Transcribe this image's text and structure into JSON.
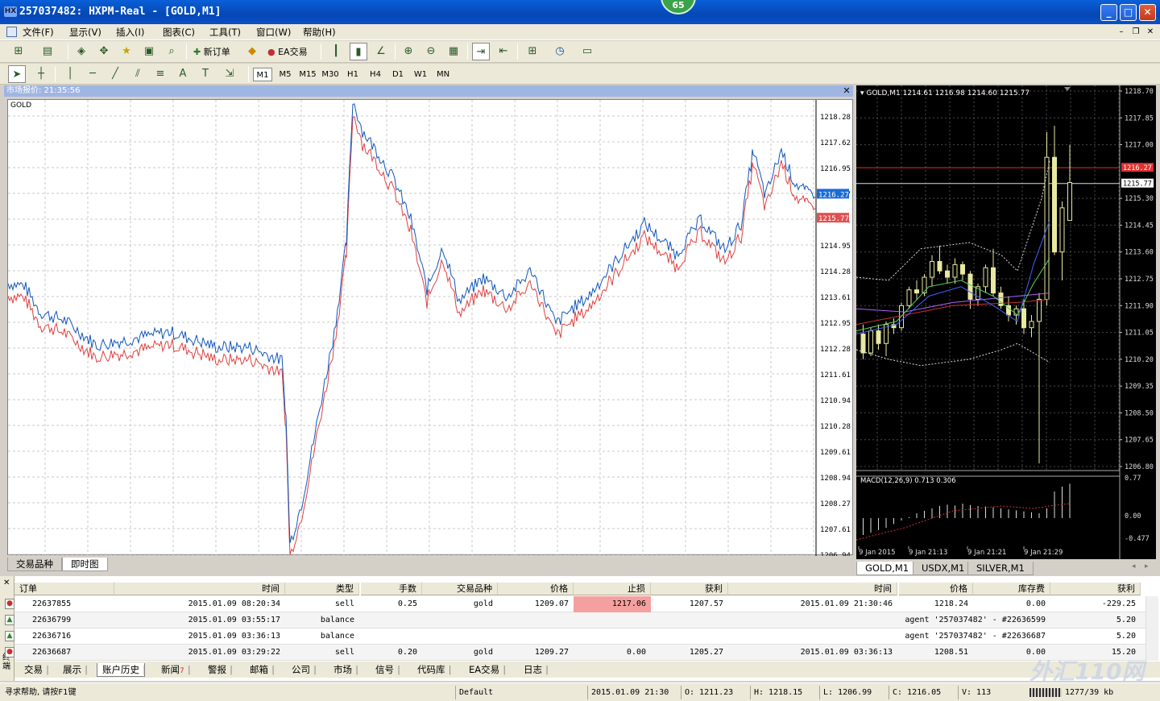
{
  "window": {
    "title": "257037482: HXPM-Real - [GOLD,M1]",
    "logo": "HX",
    "badge": "65"
  },
  "menu": [
    "文件(F)",
    "显示(V)",
    "插入(I)",
    "图表(C)",
    "工具(T)",
    "窗口(W)",
    "帮助(H)"
  ],
  "toolbar": {
    "new_order": "新订单",
    "ea_trade": "EA交易"
  },
  "timeframes": [
    "M1",
    "M5",
    "M15",
    "M30",
    "H1",
    "H4",
    "D1",
    "W1",
    "MN"
  ],
  "active_timeframe": "M1",
  "market_watch": {
    "header": "市场报价: 21:35:56",
    "tabs": [
      "交易品种",
      "即时图"
    ],
    "active_tab": "即时图"
  },
  "tick_chart": {
    "symbol": "GOLD",
    "bid_label": "1216.27",
    "ask_label": "1215.77",
    "colors": {
      "bid": "#1155bb",
      "ask": "#e04040",
      "bid_tag": "#1a6bd6",
      "ask_tag": "#e05050"
    },
    "y_ticks": [
      "1218.28",
      "1217.62",
      "1216.95",
      "1216.27",
      "1215.61",
      "1214.95",
      "1214.28",
      "1213.61",
      "1212.95",
      "1212.28",
      "1211.61",
      "1210.94",
      "1210.28",
      "1209.61",
      "1208.94",
      "1208.27",
      "1207.61",
      "1206.94"
    ]
  },
  "candle_chart": {
    "header": "GOLD,M1  1214.61 1216.98 1214.60 1215.77",
    "y_ticks": [
      "1218.70",
      "1217.85",
      "1217.00",
      "1216.27",
      "1215.77",
      "1215.30",
      "1214.45",
      "1213.60",
      "1212.75",
      "1211.90",
      "1211.05",
      "1210.20",
      "1209.35",
      "1208.50",
      "1207.65",
      "1206.80"
    ],
    "red_tag": "1216.27",
    "white_tag": "1215.77",
    "macd_label": "MACD(12,26,9) 0.713 0.306",
    "macd_ticks": [
      "0.77",
      "0.00",
      "-0.477"
    ],
    "x_labels": [
      "9 Jan 2015",
      "9 Jan 21:13",
      "9 Jan 21:21",
      "9 Jan 21:29"
    ],
    "tabs": [
      "GOLD,M1",
      "USDX,M1",
      "SILVER,M1"
    ],
    "active_tab": "GOLD,M1"
  },
  "terminal": {
    "columns": [
      "订单",
      "时间",
      "类型",
      "手数",
      "交易品种",
      "价格",
      "止损",
      "获利",
      "时间",
      "价格",
      "库存费",
      "获利"
    ],
    "rows": [
      {
        "order": "22637855",
        "time": "2015.01.09 08:20:34",
        "type": "sell",
        "lots": "0.25",
        "symbol": "gold",
        "price": "1209.07",
        "sl": "1217.06",
        "tp": "1207.57",
        "close_time": "2015.01.09 21:30:46",
        "close_price": "1218.24",
        "swap": "0.00",
        "profit": "-229.25",
        "icon": "sell"
      },
      {
        "order": "22636799",
        "time": "2015.01.09 03:55:17",
        "type": "balance",
        "comment": "agent '257037482' - #22636599",
        "profit": "5.20",
        "icon": "balance"
      },
      {
        "order": "22636716",
        "time": "2015.01.09 03:36:13",
        "type": "balance",
        "comment": "agent '257037482' - #22636687",
        "profit": "5.20",
        "icon": "balance"
      },
      {
        "order": "22636687",
        "time": "2015.01.09 03:29:22",
        "type": "sell",
        "lots": "0.20",
        "symbol": "gold",
        "price": "1209.27",
        "sl": "0.00",
        "tp": "1205.27",
        "close_time": "2015.01.09 03:36:13",
        "close_price": "1208.51",
        "swap": "0.00",
        "profit": "15.20",
        "icon": "sell"
      }
    ],
    "side_label": "终端",
    "tabs": [
      "交易",
      "展示",
      "账户历史",
      "新闻",
      "警报",
      "邮箱",
      "公司",
      "市场",
      "信号",
      "代码库",
      "EA交易",
      "日志"
    ],
    "news_badge": "7",
    "active_tab": "账户历史"
  },
  "status": {
    "help": "寻求帮助, 请按F1键",
    "profile": "Default",
    "datetime": "2015.01.09 21:30",
    "open": "O: 1211.23",
    "high": "H: 1218.15",
    "low": "L: 1206.99",
    "close": "C: 1216.05",
    "volume": "V: 113",
    "traffic": "1277/39 kb"
  },
  "watermark": "外汇110网"
}
